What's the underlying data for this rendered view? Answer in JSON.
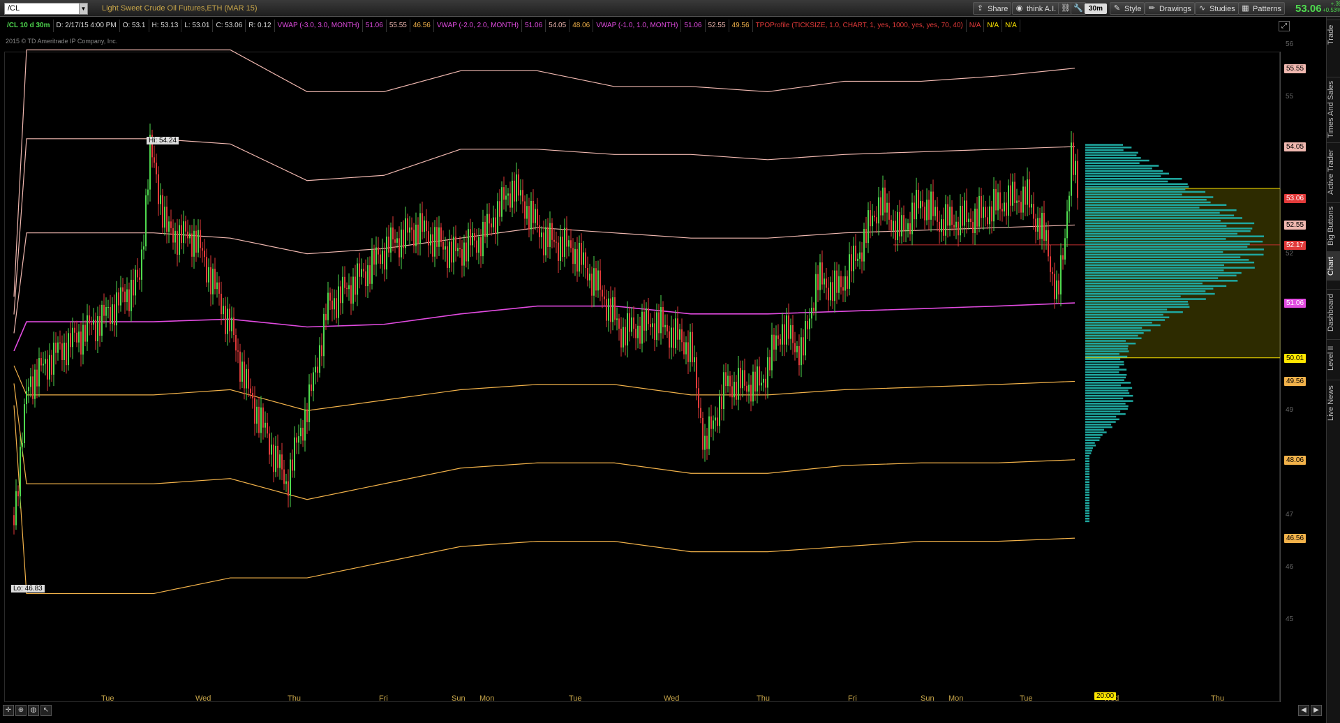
{
  "toolbar": {
    "symbol": "/CL",
    "description": "Light Sweet Crude Oil Futures,ETH (MAR 15)",
    "buttons": [
      {
        "label": "Share",
        "icon": "share-icon"
      },
      {
        "label": "think A.I.",
        "icon": "think-ai-icon"
      },
      {
        "label": "",
        "icon": "wrench-icon"
      },
      {
        "label": "Style",
        "icon": "style-icon"
      },
      {
        "label": "Drawings",
        "icon": "pencil-icon"
      },
      {
        "label": "Studies",
        "icon": "studies-icon"
      },
      {
        "label": "Patterns",
        "icon": "patterns-icon"
      }
    ],
    "timeframe": "30m",
    "last_price": "53.06",
    "net_change_abs": "+.39",
    "net_change_pct": "+0.53%"
  },
  "ohlc_bar": {
    "tag": "/CL 10 d 30m",
    "date": "D: 2/17/15 4:00 PM",
    "open": "O: 53.1",
    "high": "H: 53.13",
    "low": "L: 53.01",
    "close": "C: 53.06",
    "range": "R: 0.12",
    "vwap1": {
      "label": "VWAP (-3.0, 3.0, MONTH)",
      "v1": "51.06",
      "v2": "55.55",
      "v3": "46.56"
    },
    "vwap2": {
      "label": "VWAP (-2.0, 2.0, MONTH)",
      "v1": "51.06",
      "v2": "54.05",
      "v3": "48.06"
    },
    "vwap3": {
      "label": "VWAP (-1.0, 1.0, MONTH)",
      "v1": "51.06",
      "v2": "52.55",
      "v3": "49.56"
    },
    "tpo": {
      "label": "TPOProfile (TICKSIZE, 1.0, CHART, 1, yes, 1000, yes, yes, 70, 40)",
      "v1": "N/A",
      "v2": "N/A",
      "v3": "N/A"
    }
  },
  "copyright": "2015 © TD Ameritrade IP Company, Inc.",
  "hi_label": "Hi: 54.24",
  "lo_label": "Lo: 46.83",
  "price_tags": [
    {
      "value": "55.55",
      "color": "#f0b8b0"
    },
    {
      "value": "54.05",
      "color": "#f0b8b0"
    },
    {
      "value": "53.06",
      "color": "#e23a3a"
    },
    {
      "value": "52.55",
      "color": "#f0b8b0"
    },
    {
      "value": "52.17",
      "color": "#e23a3a"
    },
    {
      "value": "51.06",
      "color": "#e14be0"
    },
    {
      "value": "50.01",
      "color": "#ffe600"
    },
    {
      "value": "49.56",
      "color": "#f2b24a"
    },
    {
      "value": "48.06",
      "color": "#f2b24a"
    },
    {
      "value": "46.56",
      "color": "#f2b24a"
    }
  ],
  "price_ticks": [
    "56",
    "55",
    "52",
    "49",
    "47",
    "46",
    "45"
  ],
  "time_labels": [
    "Tue",
    "Wed",
    "Thu",
    "Fri",
    "Sun",
    "Mon",
    "Tue",
    "Wed",
    "Thu",
    "Fri",
    "Sun",
    "Mon",
    "Tue",
    "Wed",
    "Thu"
  ],
  "time_cursor": "20:00",
  "side_tabs": [
    "Trade",
    "Times And Sales",
    "Active Trader",
    "Big Buttons",
    "Chart",
    "Dashboard",
    "Level II",
    "Live News"
  ],
  "colors": {
    "vwap_center": "#e14be0",
    "upper_bands": "#f0b8b0",
    "lower_bands": "#f2b24a",
    "up_bar": "#4fda4f",
    "down_bar": "#e23a3a",
    "profile": "#1fa8a0",
    "value_area": "#ffe600"
  },
  "chart_data": {
    "type": "line",
    "title": "Light Sweet Crude Oil Futures,ETH (MAR 15)",
    "ylim": [
      45,
      56
    ],
    "x": [
      "Tue",
      "Wed",
      "Thu",
      "Fri",
      "Sun",
      "Mon",
      "Tue",
      "Wed",
      "Thu",
      "Fri",
      "Sun",
      "Mon",
      "Tue"
    ],
    "series": [
      {
        "name": "VWAP (-3.0, 3.0, MONTH)",
        "values": [
          55.9,
          55.9,
          55.1,
          55.1,
          55.5,
          55.5,
          55.2,
          55.2,
          55.1,
          55.3,
          55.3,
          55.4,
          55.55
        ]
      },
      {
        "name": "VWAP (-2.0, 2.0, MONTH)",
        "values": [
          54.2,
          54.1,
          53.4,
          53.5,
          54.0,
          54.0,
          53.9,
          53.9,
          53.8,
          53.9,
          53.95,
          54.0,
          54.05
        ]
      },
      {
        "name": "VWAP (-1.0, 1.0, MONTH)",
        "values": [
          52.4,
          52.3,
          52.0,
          52.1,
          52.3,
          52.5,
          52.4,
          52.3,
          52.3,
          52.4,
          52.45,
          52.5,
          52.55
        ]
      },
      {
        "name": "VWAP",
        "values": [
          50.7,
          50.75,
          50.6,
          50.65,
          50.85,
          51.0,
          51.0,
          50.85,
          50.85,
          50.9,
          50.95,
          51.0,
          51.06
        ]
      },
      {
        "name": "VWAP (-1.0, 1.0, MONTH)",
        "values": [
          49.3,
          49.4,
          49.0,
          49.2,
          49.4,
          49.5,
          49.5,
          49.3,
          49.3,
          49.4,
          49.45,
          49.5,
          49.56
        ]
      },
      {
        "name": "VWAP (-2.0, 2.0, MONTH)",
        "values": [
          47.6,
          47.7,
          47.3,
          47.6,
          47.9,
          48.0,
          48.0,
          47.8,
          47.8,
          47.95,
          48.0,
          48.0,
          48.06
        ]
      },
      {
        "name": "VWAP (-3.0, 3.0, MONTH)",
        "values": [
          45.5,
          45.8,
          45.8,
          46.1,
          46.4,
          46.5,
          46.5,
          46.3,
          46.3,
          46.4,
          46.5,
          46.5,
          46.56
        ]
      }
    ],
    "price": {
      "high": 54.24,
      "low": 46.83,
      "last": 53.06
    },
    "value_area": {
      "high": 53.25,
      "poc": 52.17,
      "low": 50.01
    }
  }
}
